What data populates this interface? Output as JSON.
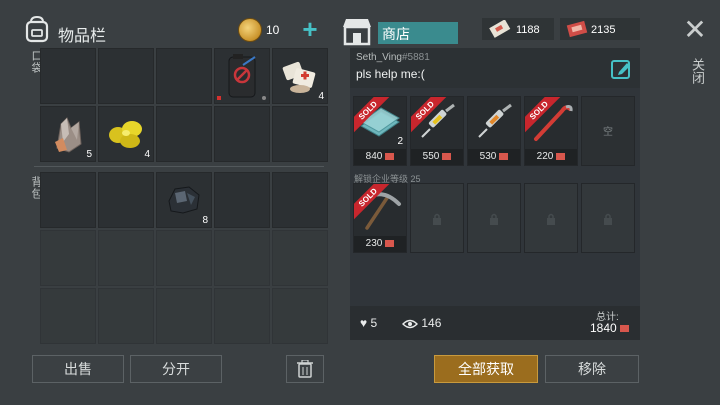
{
  "inventory": {
    "title": "物品栏",
    "coins": "10",
    "pocket_label": "口袋",
    "backpack_label": "背包",
    "pocket_items": [
      {
        "name": "",
        "qty": ""
      },
      {
        "name": "",
        "qty": ""
      },
      {
        "name": "",
        "qty": ""
      },
      {
        "name": "gas-tank",
        "qty": ""
      },
      {
        "name": "medkit",
        "qty": "4"
      },
      {
        "name": "crystal-ore",
        "qty": "5"
      },
      {
        "name": "gold-nuggets",
        "qty": "4"
      },
      {
        "name": "",
        "qty": ""
      },
      {
        "name": "",
        "qty": ""
      },
      {
        "name": "",
        "qty": ""
      }
    ],
    "backpack_items": [
      {
        "name": "",
        "qty": ""
      },
      {
        "name": "",
        "qty": ""
      },
      {
        "name": "coal-ore",
        "qty": "8"
      },
      {
        "name": "",
        "qty": ""
      },
      {
        "name": "",
        "qty": ""
      }
    ],
    "sell_label": "出售",
    "split_label": "分开"
  },
  "shop": {
    "title": "商店",
    "currency1": "1188",
    "currency2": "2135",
    "seller_name": "Seth_Ving",
    "seller_id": "#5881",
    "message": "pls help me:(",
    "slots": [
      {
        "name": "glass-sheets",
        "sold": "SOLD",
        "count": "2",
        "price": "840"
      },
      {
        "name": "syringe-yellow",
        "sold": "SOLD",
        "count": "",
        "price": "550"
      },
      {
        "name": "syringe-orange",
        "sold": "",
        "count": "",
        "price": "530"
      },
      {
        "name": "crowbar",
        "sold": "SOLD",
        "count": "",
        "price": "220"
      },
      {
        "name": "empty",
        "sold": "",
        "count": "",
        "price": "",
        "empty_label": "空"
      }
    ],
    "unlock_text": "解锁企业等级 25",
    "slots_row2": [
      {
        "name": "pickaxe",
        "sold": "SOLD",
        "price": "230"
      }
    ],
    "likes": "5",
    "views": "146",
    "total_label": "总计:",
    "total_value": "1840",
    "get_all_label": "全部获取",
    "remove_label": "移除"
  },
  "close_label": "关闭",
  "colors": {
    "accent_teal": "#46c1c6",
    "sold_red": "#c8262d",
    "get_all_gold": "#9b6d1e"
  }
}
